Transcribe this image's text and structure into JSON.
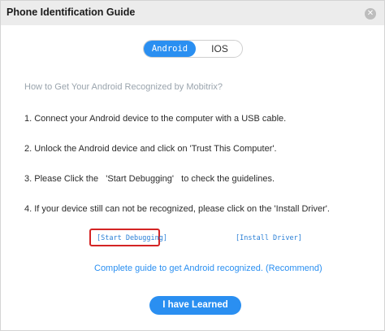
{
  "window": {
    "title": "Phone Identification Guide",
    "close_icon": "close-icon"
  },
  "os_toggle": {
    "options": [
      "Android",
      "IOS"
    ],
    "selected": "Android"
  },
  "guide": {
    "heading": "How to Get Your Android Recognized by Mobitrix?",
    "steps": [
      "1. Connect your Android device to the computer with a USB cable.",
      "2. Unlock the Android device and click on 'Trust This Computer'.",
      "3. Please Click the   'Start Debugging'   to check the guidelines.",
      "4. If your device still can not be recognized, please click on the 'Install Driver'."
    ]
  },
  "links": {
    "start_debugging": "[Start Debugging]",
    "install_driver": "[Install Driver]",
    "complete_guide": "Complete guide to get Android recognized. (Recommend)"
  },
  "actions": {
    "learned": "I have Learned"
  },
  "colors": {
    "accent": "#2a8ff1",
    "highlight_border": "#d42424",
    "titlebar": "#ececec"
  }
}
